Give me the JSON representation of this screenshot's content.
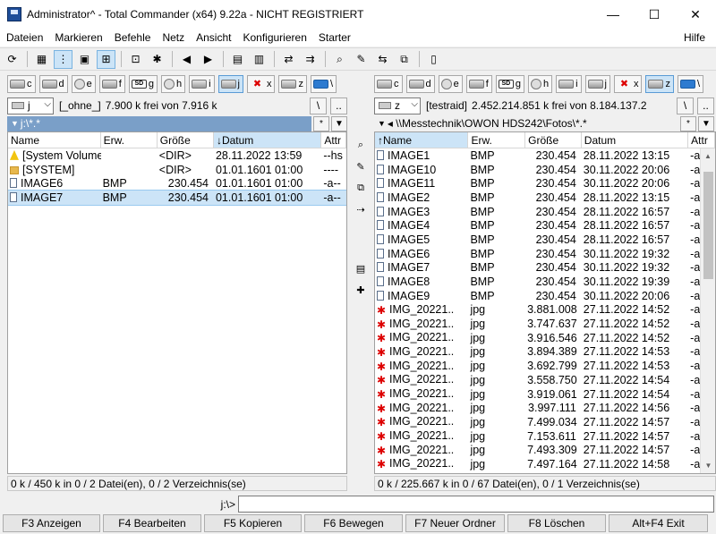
{
  "window": {
    "title": "Administrator^ - Total Commander (x64) 9.22a - NICHT REGISTRIERT",
    "minimize": "—",
    "maximize": "☐",
    "close": "✕"
  },
  "menu": [
    "Dateien",
    "Markieren",
    "Befehle",
    "Netz",
    "Ansicht",
    "Konfigurieren",
    "Starter"
  ],
  "menu_help": "Hilfe",
  "toolbar": [
    {
      "icon": "refresh-icon",
      "glyph": "⟳"
    },
    {
      "icon": "brief-view-icon",
      "glyph": "▦"
    },
    {
      "icon": "detailed-view-icon",
      "glyph": "⋮",
      "active": true
    },
    {
      "icon": "thumbnail-view-icon",
      "glyph": "▣"
    },
    {
      "icon": "tree-view-icon",
      "glyph": "⊞",
      "active": true
    },
    {
      "icon": "invert-selection-icon",
      "glyph": "⊡"
    },
    {
      "icon": "compare-dirs-icon",
      "glyph": "✱"
    },
    {
      "icon": "back-icon",
      "glyph": "◀"
    },
    {
      "icon": "forward-icon",
      "glyph": "▶"
    },
    {
      "icon": "pack-icon",
      "glyph": "▤"
    },
    {
      "icon": "unpack-icon",
      "glyph": "▥"
    },
    {
      "icon": "ftp-connect-icon",
      "glyph": "⇄"
    },
    {
      "icon": "ftp-url-icon",
      "glyph": "⇉"
    },
    {
      "icon": "search-icon",
      "glyph": "⌕"
    },
    {
      "icon": "multi-rename-icon",
      "glyph": "✎"
    },
    {
      "icon": "sync-dirs-icon",
      "glyph": "⇆"
    },
    {
      "icon": "copy-names-icon",
      "glyph": "⧉"
    },
    {
      "icon": "notepad-icon",
      "glyph": "▯"
    }
  ],
  "left": {
    "drives": [
      {
        "label": "c",
        "type": "hd"
      },
      {
        "label": "d",
        "type": "hd"
      },
      {
        "label": "e",
        "type": "cd"
      },
      {
        "label": "f",
        "type": "hd"
      },
      {
        "label": "g",
        "type": "sd"
      },
      {
        "label": "h",
        "type": "cd"
      },
      {
        "label": "i",
        "type": "hd"
      },
      {
        "label": "j",
        "type": "hd",
        "active": true
      },
      {
        "label": "x",
        "type": "red"
      },
      {
        "label": "z",
        "type": "hd"
      },
      {
        "label": "\\",
        "type": "net"
      }
    ],
    "drive_combo": "j",
    "volume_label": "[_ohne_]",
    "free_space": "7.900 k frei von 7.916 k",
    "root_button": "\\",
    "parent_button": "..",
    "path": "j:\\*.*",
    "path_star": "*",
    "columns": [
      {
        "label": "Name",
        "sorted": false
      },
      {
        "label": "Erw.",
        "sorted": false
      },
      {
        "label": "Größe",
        "sorted": false
      },
      {
        "label": "↓Datum",
        "sorted": true
      },
      {
        "label": "Attr",
        "sorted": false
      }
    ],
    "files": [
      {
        "icon": "warn",
        "name": "[System Volume Infor..]",
        "ext": "",
        "size": "<DIR>",
        "date": "28.11.2022 13:59",
        "attr": "--hs",
        "size_left": true
      },
      {
        "icon": "folder",
        "name": "[SYSTEM]",
        "ext": "",
        "size": "<DIR>",
        "date": "01.01.1601 01:00",
        "attr": "----",
        "size_left": true
      },
      {
        "icon": "file",
        "name": "IMAGE6",
        "ext": "BMP",
        "size": "230.454",
        "date": "01.01.1601 01:00",
        "attr": "-a--"
      },
      {
        "icon": "file",
        "name": "IMAGE7",
        "ext": "BMP",
        "size": "230.454",
        "date": "01.01.1601 01:00",
        "attr": "-a--",
        "selected": true
      }
    ],
    "status": "0 k / 450 k in 0 / 2 Datei(en), 0 / 2 Verzeichnis(se)"
  },
  "right": {
    "drives": [
      {
        "label": "c",
        "type": "hd"
      },
      {
        "label": "d",
        "type": "hd"
      },
      {
        "label": "e",
        "type": "cd"
      },
      {
        "label": "f",
        "type": "hd"
      },
      {
        "label": "g",
        "type": "sd"
      },
      {
        "label": "h",
        "type": "cd"
      },
      {
        "label": "i",
        "type": "hd"
      },
      {
        "label": "j",
        "type": "hd"
      },
      {
        "label": "x",
        "type": "red"
      },
      {
        "label": "z",
        "type": "hd",
        "active": true
      },
      {
        "label": "\\",
        "type": "net"
      }
    ],
    "drive_combo": "z",
    "volume_label": "[testraid]",
    "free_space": "2.452.214.851 k frei von 8.184.137.2",
    "root_button": "\\",
    "parent_button": "..",
    "path": "◂ \\\\Messtechnik\\OWON HDS242\\Fotos\\*.*",
    "path_star": "*",
    "columns": [
      {
        "label": "↑Name",
        "sorted": true
      },
      {
        "label": "Erw.",
        "sorted": false
      },
      {
        "label": "Größe",
        "sorted": false
      },
      {
        "label": "Datum",
        "sorted": false
      },
      {
        "label": "Attr",
        "sorted": false
      }
    ],
    "files": [
      {
        "icon": "file",
        "name": "IMAGE1",
        "ext": "BMP",
        "size": "230.454",
        "date": "28.11.2022 13:15",
        "attr": "-a"
      },
      {
        "icon": "file",
        "name": "IMAGE10",
        "ext": "BMP",
        "size": "230.454",
        "date": "30.11.2022 20:06",
        "attr": "-a"
      },
      {
        "icon": "file",
        "name": "IMAGE11",
        "ext": "BMP",
        "size": "230.454",
        "date": "30.11.2022 20:06",
        "attr": "-a"
      },
      {
        "icon": "file",
        "name": "IMAGE2",
        "ext": "BMP",
        "size": "230.454",
        "date": "28.11.2022 13:15",
        "attr": "-a"
      },
      {
        "icon": "file",
        "name": "IMAGE3",
        "ext": "BMP",
        "size": "230.454",
        "date": "28.11.2022 16:57",
        "attr": "-a"
      },
      {
        "icon": "file",
        "name": "IMAGE4",
        "ext": "BMP",
        "size": "230.454",
        "date": "28.11.2022 16:57",
        "attr": "-a"
      },
      {
        "icon": "file",
        "name": "IMAGE5",
        "ext": "BMP",
        "size": "230.454",
        "date": "28.11.2022 16:57",
        "attr": "-a"
      },
      {
        "icon": "file",
        "name": "IMAGE6",
        "ext": "BMP",
        "size": "230.454",
        "date": "30.11.2022 19:32",
        "attr": "-a"
      },
      {
        "icon": "file",
        "name": "IMAGE7",
        "ext": "BMP",
        "size": "230.454",
        "date": "30.11.2022 19:32",
        "attr": "-a"
      },
      {
        "icon": "file",
        "name": "IMAGE8",
        "ext": "BMP",
        "size": "230.454",
        "date": "30.11.2022 19:39",
        "attr": "-a"
      },
      {
        "icon": "file",
        "name": "IMAGE9",
        "ext": "BMP",
        "size": "230.454",
        "date": "30.11.2022 20:06",
        "attr": "-a"
      },
      {
        "icon": "jpg",
        "name": "IMG_20221..",
        "ext": "jpg",
        "size": "3.881.008",
        "date": "27.11.2022 14:52",
        "attr": "-a"
      },
      {
        "icon": "jpg",
        "name": "IMG_20221..",
        "ext": "jpg",
        "size": "3.747.637",
        "date": "27.11.2022 14:52",
        "attr": "-a"
      },
      {
        "icon": "jpg",
        "name": "IMG_20221..",
        "ext": "jpg",
        "size": "3.916.546",
        "date": "27.11.2022 14:52",
        "attr": "-a"
      },
      {
        "icon": "jpg",
        "name": "IMG_20221..",
        "ext": "jpg",
        "size": "3.894.389",
        "date": "27.11.2022 14:53",
        "attr": "-a"
      },
      {
        "icon": "jpg",
        "name": "IMG_20221..",
        "ext": "jpg",
        "size": "3.692.799",
        "date": "27.11.2022 14:53",
        "attr": "-a"
      },
      {
        "icon": "jpg",
        "name": "IMG_20221..",
        "ext": "jpg",
        "size": "3.558.750",
        "date": "27.11.2022 14:54",
        "attr": "-a"
      },
      {
        "icon": "jpg",
        "name": "IMG_20221..",
        "ext": "jpg",
        "size": "3.919.061",
        "date": "27.11.2022 14:54",
        "attr": "-a"
      },
      {
        "icon": "jpg",
        "name": "IMG_20221..",
        "ext": "jpg",
        "size": "3.997.111",
        "date": "27.11.2022 14:56",
        "attr": "-a"
      },
      {
        "icon": "jpg",
        "name": "IMG_20221..",
        "ext": "jpg",
        "size": "7.499.034",
        "date": "27.11.2022 14:57",
        "attr": "-a"
      },
      {
        "icon": "jpg",
        "name": "IMG_20221..",
        "ext": "jpg",
        "size": "7.153.611",
        "date": "27.11.2022 14:57",
        "attr": "-a"
      },
      {
        "icon": "jpg",
        "name": "IMG_20221..",
        "ext": "jpg",
        "size": "7.493.309",
        "date": "27.11.2022 14:57",
        "attr": "-a"
      },
      {
        "icon": "jpg",
        "name": "IMG_20221..",
        "ext": "jpg",
        "size": "7.497.164",
        "date": "27.11.2022 14:58",
        "attr": "-a"
      }
    ],
    "status": "0 k / 225.667 k in 0 / 67 Datei(en), 0 / 1 Verzeichnis(se)"
  },
  "middle_buttons": [
    {
      "icon": "view-file-icon",
      "glyph": "⌕"
    },
    {
      "icon": "edit-file-icon",
      "glyph": "✎"
    },
    {
      "icon": "copy-file-icon",
      "glyph": "⧉"
    },
    {
      "icon": "move-file-icon",
      "glyph": "⇢"
    },
    {
      "icon": "pack-files-icon",
      "glyph": "▤"
    },
    {
      "icon": "new-folder-icon",
      "glyph": "✚"
    }
  ],
  "command_prompt": "j:\\>",
  "command_value": "",
  "fkeys": [
    {
      "label": "F3 Anzeigen",
      "width": 109
    },
    {
      "label": "F4 Bearbeiten",
      "width": 110
    },
    {
      "label": "F5 Kopieren",
      "width": 109
    },
    {
      "label": "F6 Bewegen",
      "width": 110
    },
    {
      "label": "F7 Neuer Ordner",
      "width": 111
    },
    {
      "label": "F8 Löschen",
      "width": 110
    },
    {
      "label": "Alt+F4 Exit",
      "width": 111
    }
  ]
}
